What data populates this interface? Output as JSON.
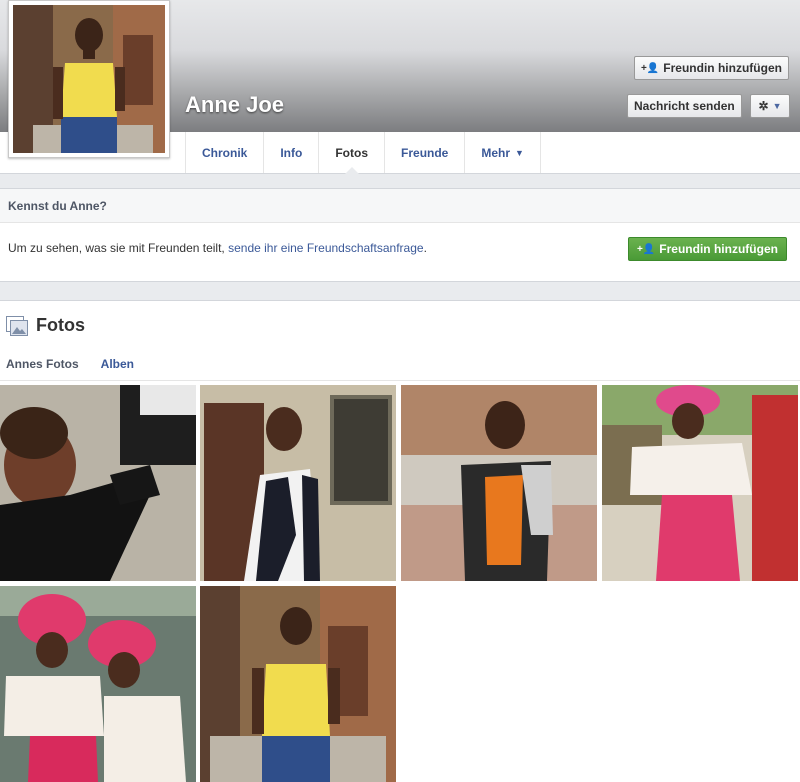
{
  "profile": {
    "name": "Anne Joe",
    "add_friend_label": "Freundin hinzufügen",
    "message_label": "Nachricht senden"
  },
  "tabs": [
    {
      "label": "Chronik"
    },
    {
      "label": "Info"
    },
    {
      "label": "Fotos",
      "active": true
    },
    {
      "label": "Freunde"
    },
    {
      "label": "Mehr"
    }
  ],
  "know": {
    "heading": "Kennst du Anne?",
    "text_before": "Um zu sehen, was sie mit Freunden teilt, ",
    "link_text": "sende ihr eine Freundschaftsanfrage",
    "text_after": ".",
    "button_label": "Freundin hinzufügen"
  },
  "photos": {
    "title": "Fotos",
    "subtabs": [
      {
        "label": "Annes Fotos",
        "active": true
      },
      {
        "label": "Alben"
      }
    ]
  },
  "icons": {
    "add_friend": "add-friend-icon",
    "gear": "gear-icon",
    "dropdown": "chevron-down-icon",
    "photos": "photos-icon"
  },
  "colors": {
    "link": "#3b5998",
    "green_button": "#4a9a36",
    "band": "#e9ebee"
  }
}
